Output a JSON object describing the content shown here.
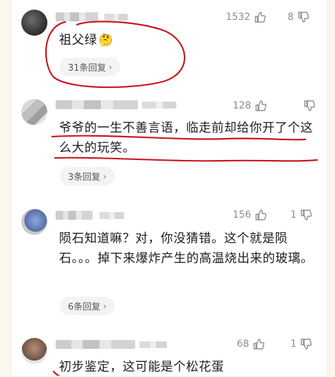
{
  "comments": [
    {
      "likes": "1532",
      "dislikes": "8",
      "text": "祖父绿",
      "emoji": "🤔",
      "replies": "31条回复"
    },
    {
      "likes": "128",
      "dislikes": "",
      "text": "爷爷的一生不善言语，临走前却给你开了个这么大的玩笑。",
      "replies": "3条回复"
    },
    {
      "likes": "156",
      "dislikes": "1",
      "text": "陨石知道嘛？对，你没猜错。这个就是陨石。。。掉下来爆炸产生的高温烧出来的玻璃。",
      "replies": "6条回复"
    },
    {
      "likes": "68",
      "dislikes": "1",
      "text": "初步鉴定，这可能是个松花蛋"
    }
  ],
  "colors": {
    "ink": "#c8161d",
    "muted": "#8d8d8d",
    "text": "#1e1e1e",
    "pill": "#f3f3f3"
  },
  "icons": [
    "thumbs-up-icon",
    "thumbs-down-icon",
    "chevron-right-icon"
  ]
}
